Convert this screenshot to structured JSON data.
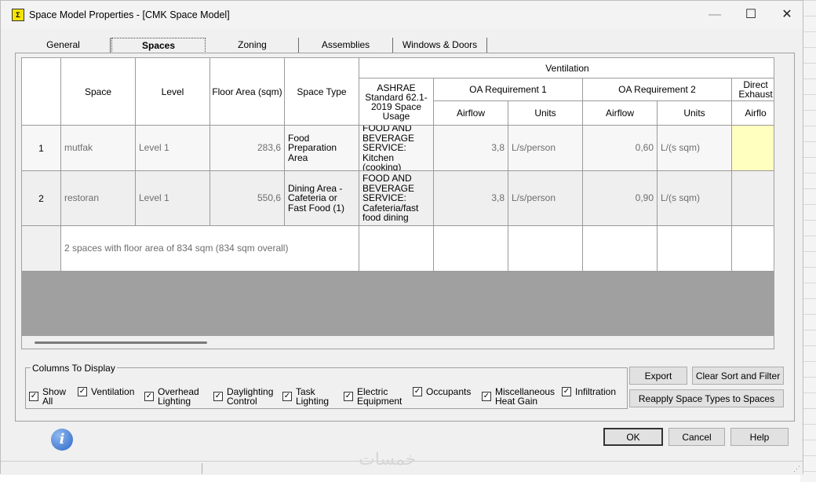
{
  "window": {
    "title": "Space Model Properties - [CMK Space Model]"
  },
  "tabs": [
    "General",
    "Spaces",
    "Zoning",
    "Assemblies",
    "Windows & Doors"
  ],
  "grid": {
    "headers": {
      "space": "Space",
      "level": "Level",
      "floor_area": "Floor Area (sqm)",
      "space_type": "Space Type",
      "ventilation": "Ventilation",
      "ashrae": "ASHRAE Standard 62.1-2019  Space Usage",
      "oa1": "OA Requirement 1",
      "oa2": "OA Requirement 2",
      "direct_exhaust": "Direct Exhaust",
      "airflow": "Airflow",
      "units": "Units",
      "airflow_cut": "Airflo"
    },
    "rows": [
      {
        "num": "1",
        "space": "mutfak",
        "level": "Level 1",
        "floor_area": "283,6",
        "space_type": "Food Preparation Area",
        "usage": "FOOD AND BEVERAGE SERVICE: Kitchen (cooking)",
        "oa1_airflow": "3,8",
        "oa1_units": "L/s/person",
        "oa2_airflow": "0,60",
        "oa2_units": "L/(s sqm)"
      },
      {
        "num": "2",
        "space": "restoran",
        "level": "Level 1",
        "floor_area": "550,6",
        "space_type": "Dining Area - Cafeteria or Fast Food (1)",
        "usage": "FOOD AND BEVERAGE SERVICE: Cafeteria/fast food dining",
        "oa1_airflow": "3,8",
        "oa1_units": "L/s/person",
        "oa2_airflow": "0,90",
        "oa2_units": "L/(s sqm)"
      }
    ],
    "summary": "2 spaces with floor area of 834 sqm (834 sqm overall)"
  },
  "columns_to_display": {
    "legend": "Columns To Display",
    "options": [
      {
        "label1": "Show",
        "label2": "All",
        "checked": true
      },
      {
        "label1": "Ventilation",
        "label2": "",
        "checked": true
      },
      {
        "label1": "Overhead",
        "label2": "Lighting",
        "checked": true
      },
      {
        "label1": "Daylighting",
        "label2": "Control",
        "checked": true
      },
      {
        "label1": "Task",
        "label2": "Lighting",
        "checked": true
      },
      {
        "label1": "Electric",
        "label2": "Equipment",
        "checked": true
      },
      {
        "label1": "Occupants",
        "label2": "",
        "checked": true
      },
      {
        "label1": "Miscellaneous",
        "label2": "Heat Gain",
        "checked": true
      },
      {
        "label1": "Infiltration",
        "label2": "",
        "checked": true
      }
    ]
  },
  "buttons": {
    "export": "Export",
    "clear_sort": "Clear Sort and Filter",
    "reapply": "Reapply Space Types to Spaces",
    "ok": "OK",
    "cancel": "Cancel",
    "help": "Help"
  },
  "check_glyph": "✓",
  "watermark": "خمسات"
}
